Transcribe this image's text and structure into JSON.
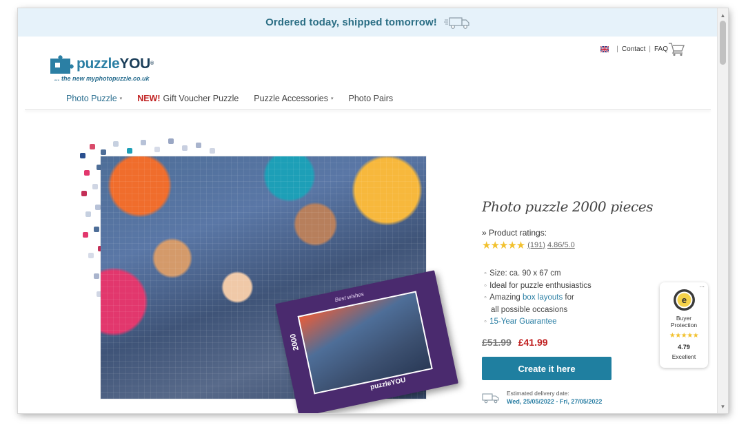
{
  "banner": {
    "text": "Ordered today, shipped tomorrow!"
  },
  "header": {
    "logo": {
      "puzzle": "puzzle",
      "you": "YOU",
      "reg": "®",
      "tagline": "... the new myphotopuzzle.co.uk"
    },
    "links": {
      "contact": "Contact",
      "faq": "FAQ"
    }
  },
  "nav": {
    "photo_puzzle": "Photo Puzzle",
    "new_label": "NEW!",
    "gift_voucher": "Gift Voucher Puzzle",
    "accessories": "Puzzle Accessories",
    "photo_pairs": "Photo Pairs"
  },
  "product": {
    "title": "Photo puzzle 2000 pieces",
    "ratings_label": "» Product ratings:",
    "stars": "★★★★★",
    "rating_count": "(191)",
    "rating_score": "4.86/5.0",
    "features": {
      "size": "Size: ca. 90 x 67 cm",
      "ideal": "Ideal for puzzle enthusiastics",
      "amazing_pre": "Amazing",
      "amazing_link": "box layouts",
      "amazing_post": "for",
      "amazing_line2": "all possible occasions",
      "guarantee": "15-Year Guarantee"
    },
    "old_price": "£51.99",
    "new_price": "£41.99",
    "cta": "Create it here",
    "delivery_label": "Estimated delivery date:",
    "delivery_dates": "Wed, 25/05/2022 - Fri, 27/05/2022",
    "box": {
      "wishes": "Best wishes",
      "count": "2000",
      "brand": "puzzleYOU"
    }
  },
  "trust_badge": {
    "menu": "...",
    "label_line1": "Buyer",
    "label_line2": "Protection",
    "stars": "★★★★★",
    "score": "4.79",
    "word": "Excellent"
  },
  "colors": {
    "brand": "#2b7fa4",
    "cta": "#1f7fa0",
    "price": "#c01f1f",
    "banner_bg": "#e6f2fa"
  },
  "icons": [
    "truck-icon",
    "flag-icon",
    "cart-icon",
    "delivery-truck-icon",
    "trust-seal-icon"
  ]
}
